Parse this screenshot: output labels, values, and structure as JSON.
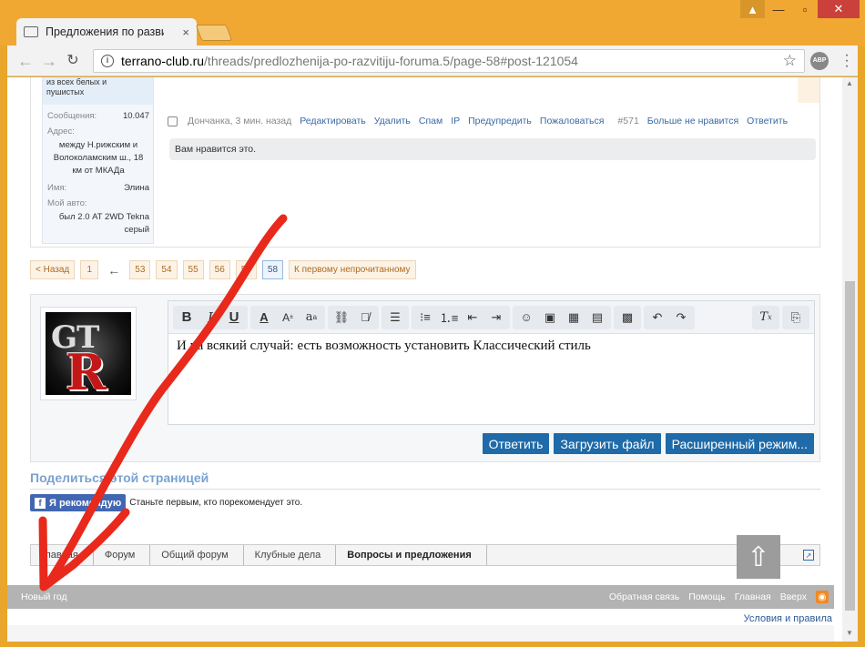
{
  "browser": {
    "tab_title": "Предложения по развитию",
    "tab_close": "×",
    "url_host": "terrano-club.ru",
    "url_path": "/threads/predlozhenija-po-razvitiju-foruma.5/page-58#post-121054",
    "abp_label": "ABP"
  },
  "post": {
    "mood_line1": "из всех белых и",
    "mood_line2": "пушистых",
    "messages_label": "Сообщения:",
    "messages_value": "10.047",
    "address_label": "Адрес:",
    "address_line1": "между Н.рижским и",
    "address_line2": "Волоколамским ш., 18",
    "address_line3": "км от МКАДа",
    "name_label": "Имя:",
    "name_value": "Элина",
    "car_label": "Мой авто:",
    "car_line1": "был 2.0 AT 2WD Tekna",
    "car_line2": "серый",
    "author_time": "Дончанка, 3 мин. назад",
    "actions": [
      "Редактировать",
      "Удалить",
      "Спам",
      "IP",
      "Предупредить",
      "Пожаловаться"
    ],
    "post_number": "#571",
    "unlike": "Больше не нравится",
    "reply": "Ответить",
    "likes_text": "Вам нравится это."
  },
  "pager": {
    "prev": "< Назад",
    "pages_before": [
      "1"
    ],
    "ellipsis_arrow": "←",
    "pages": [
      "53",
      "54",
      "55",
      "56",
      "57"
    ],
    "current": "58",
    "first_unread": "К первому непрочитанному"
  },
  "editor": {
    "text": "И на всякий случай: есть возможность установить Классический стиль",
    "buttons": {
      "reply": "Ответить",
      "upload": "Загрузить файл",
      "advanced": "Расширенный режим..."
    },
    "toolbar_icons": [
      "bold-icon",
      "italic-icon",
      "underline-icon",
      "text-color-icon",
      "font-size-icon",
      "font-family-icon",
      "link-icon",
      "unlink-icon",
      "align-icon",
      "bullet-list-icon",
      "numbered-list-icon",
      "outdent-icon",
      "indent-icon",
      "smilie-icon",
      "image-icon",
      "media-icon",
      "quote-icon",
      "save-draft-icon",
      "undo-icon",
      "redo-icon",
      "remove-format-icon",
      "toggle-bbcode-icon"
    ]
  },
  "share": {
    "title": "Поделиться этой страницей",
    "fb_button": "Я рекомендую",
    "fb_text": "Станьте первым, кто порекомендует это."
  },
  "breadcrumbs": [
    "Главная",
    "Форум",
    "Общий форум",
    "Клубные дела",
    "Вопросы и предложения"
  ],
  "footer": {
    "style": "Новый год",
    "links": [
      "Обратная связь",
      "Помощь",
      "Главная",
      "Вверх"
    ],
    "terms": "Условия и правила"
  },
  "annotation": {
    "stroke_color": "#e8291c"
  }
}
